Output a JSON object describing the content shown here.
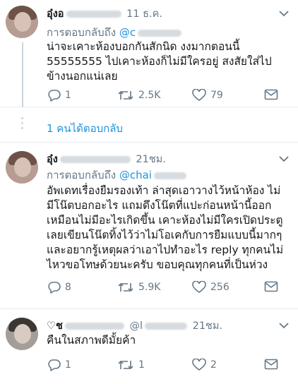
{
  "tweets": [
    {
      "name": "อุ๋งอ",
      "time": "11 ธ.ค.",
      "replying_to_label": "การตอบกลับถึง",
      "mention": "@c",
      "lines": [
        "น่าจะเคาะห้องบอกกันสักนิด งงมากตอนนี้",
        "55555555 ไปเคาะห้องก็ไม่มีใครอยู่ สงสัยใส่ไป",
        "ข้างนอกแน่เลย"
      ],
      "replies": "1",
      "retweets": "2.5K",
      "likes": "79"
    },
    {
      "name": "อุ๋ง",
      "time": "21ชม.",
      "replying_to_label": "การตอบกลับถึง",
      "mention": "@chai",
      "lines": [
        "อัพเดทเรื่องยืมรองเท้า ล่าสุดเอาวางไว้หน้าห้อง ไม่",
        "มีโน๊ตบอกอะไร แถมดึงโน๊ตที่แปะก่อนหน้านี้ออก",
        "เหมือนไม่มีอะไรเกิดขึ้น เคาะห้องไม่มีใครเปิดประตู",
        "เลยเขียนโน๊ตทิ้งไว้ว่าไม่โอเคกับการยืมแบบนี้มากๆ",
        "และอยากรู้เหตุผลว่าเอาไปทำอะไร reply ทุกคนไม่",
        "ไหวขอโทษด้วยนะครับ ขอบคุณทุกคนที่เป็นห่วง"
      ],
      "replies": "8",
      "retweets": "5.9K",
      "likes": "256"
    },
    {
      "name": "♡ช",
      "handle": "@l",
      "time": "21ชม.",
      "lines": [
        "คืนในสภาพดีมั้ยค้า"
      ],
      "replies": "1",
      "retweets": "1",
      "likes": "2"
    }
  ],
  "thread": {
    "show_replies": "1 คนได้ตอบกลับ"
  },
  "colors": {
    "accent": "#1b95e0",
    "muted": "#657786",
    "divider": "#e6ecf0"
  },
  "icons": [
    "chevron-down-icon",
    "reply-icon",
    "retweet-icon",
    "like-icon",
    "message-icon"
  ]
}
